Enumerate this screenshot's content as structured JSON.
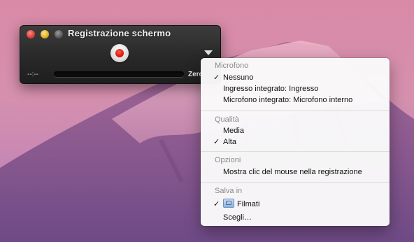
{
  "window": {
    "title": "Registrazione schermo",
    "time": "--:--",
    "size_label": "Zero"
  },
  "menu": {
    "sections": {
      "microphone": {
        "header": "Microfono",
        "items": [
          {
            "label": "Nessuno",
            "checked": true
          },
          {
            "label": "Ingresso integrato: Ingresso",
            "checked": false
          },
          {
            "label": "Microfono integrato: Microfono interno",
            "checked": false
          }
        ]
      },
      "quality": {
        "header": "Qualità",
        "items": [
          {
            "label": "Media",
            "checked": false
          },
          {
            "label": "Alta",
            "checked": true
          }
        ]
      },
      "options": {
        "header": "Opzioni",
        "items": [
          {
            "label": "Mostra clic del mouse nella registrazione",
            "checked": false
          }
        ]
      },
      "save_in": {
        "header": "Salva in",
        "items": [
          {
            "label": "Filmati",
            "checked": true,
            "icon": "movies-folder-icon"
          },
          {
            "label": "Scegli…",
            "checked": false
          }
        ]
      }
    },
    "check_mark": "✓"
  },
  "colors": {
    "record_red": "#d9140a",
    "menu_header_gray": "#8a8a8a"
  }
}
